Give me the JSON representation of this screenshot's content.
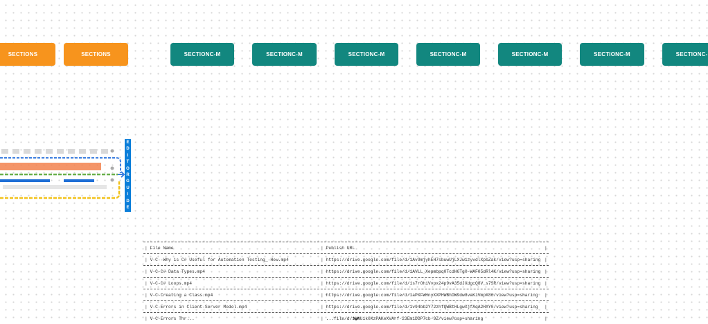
{
  "canvas": {
    "sections_left": [
      {
        "label": "SECTIONS"
      },
      {
        "label": "SECTIONS"
      }
    ],
    "sections_right": [
      {
        "label": "SECTIONC-M"
      },
      {
        "label": "SECTIONC-M"
      },
      {
        "label": "SECTIONC-M"
      },
      {
        "label": "SECTIONC-M"
      },
      {
        "label": "SECTIONC-M"
      },
      {
        "label": "SECTIONC-M"
      },
      {
        "label": "SECTIONC-M"
      }
    ],
    "editor_guide": [
      "E",
      "D",
      "I",
      "T",
      "O",
      "R",
      "G",
      "U",
      "I",
      "D",
      "E"
    ],
    "colors": {
      "orange": "#f7941d",
      "teal": "#12877f",
      "guide_blue": "#0b7ed9"
    }
  },
  "table": {
    "headers": [
      "File Name",
      "Publish URL"
    ],
    "rows": [
      [
        "V-C--Why is C# Useful for Automation Testing_-How.mp4",
        "https://drive.google.com/file/d/1Av9mjyhEH7sbuwUjLXJw1zyvdlXpbZak/view?usp=sharing"
      ],
      [
        "V-C-C# Data Types.mp4",
        "https://drive.google.com/file/d/1AVLL_Xepmbpq0TcdH6Tg0-WAF05dRl4K/view?usp=sharing"
      ],
      [
        "V-C-C# Loops.mp4",
        "https://drive.google.com/file/d/1s7rOhiVvpx24p9vA35dJXdgcQ8V_s7SR/view?usp=sharing"
      ],
      [
        "V-C-Creating a Class.mp4",
        "https://drive.google.com/file/d/1aPXFWHnyXXPHWBhDW9dw8vaKiVmpX86/view?usp=sharing"
      ],
      [
        "V-C-Errors in Client-Server Model.mp4",
        "https://drive.google.com/file/d/1v94bb2Y72zhfQWBtHLgwXjfAqA2HXY0/view?usp=sharing"
      ],
      [
        "V-C-Errors Thr...",
        "...file/d/1kWUik0XzPAKeXVArf-23Em1DDP7cb-9Z/view?usp=sharing"
      ]
    ]
  }
}
